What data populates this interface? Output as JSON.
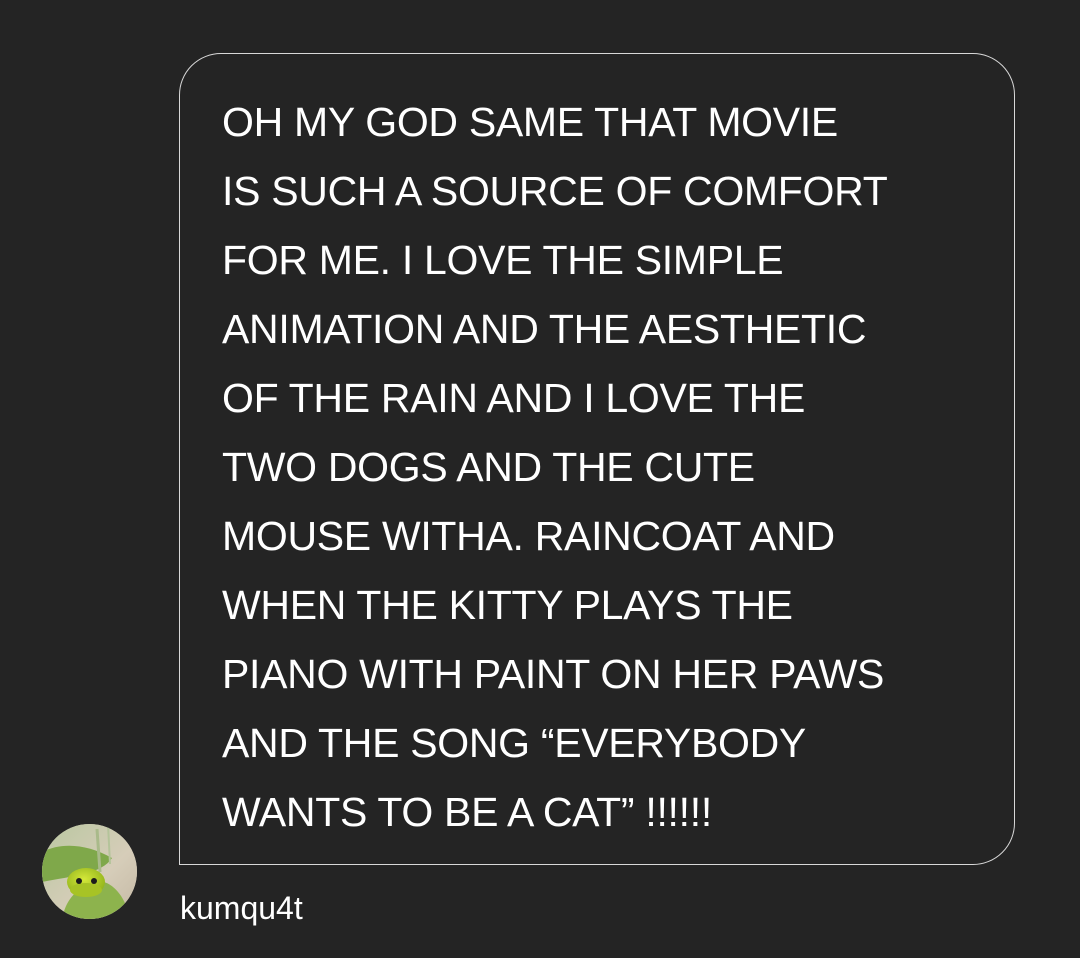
{
  "message": {
    "lines": [
      "OH MY GOD SAME THAT MOVIE",
      "IS SUCH A SOURCE OF COMFORT",
      "FOR ME. I LOVE THE SIMPLE",
      "ANIMATION AND THE AESTHETIC",
      "OF THE RAIN AND I LOVE THE",
      "TWO DOGS AND THE CUTE",
      "MOUSE WITHA. RAINCOAT AND",
      "WHEN THE KITTY PLAYS THE",
      "PIANO WITH PAINT ON HER PAWS",
      "AND THE SONG “EVERYBODY",
      "WANTS TO BE A CAT” !!!!!!"
    ]
  },
  "sender": {
    "username": "kumqu4t",
    "avatar_icon": "frog-avatar-icon"
  },
  "colors": {
    "background": "#242424",
    "bubble_border": "#d8d8d8",
    "text": "#ffffff"
  }
}
